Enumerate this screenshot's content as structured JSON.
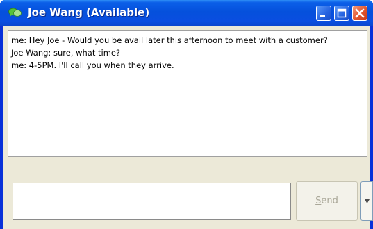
{
  "window": {
    "title": "Joe Wang (Available)",
    "controls": {
      "minimize_icon": "minimize-icon",
      "maximize_icon": "maximize-icon",
      "close_icon": "close-icon"
    }
  },
  "transcript": {
    "messages": [
      "me: Hey Joe - Would you be avail later this afternoon to meet with a  customer?",
      "Joe Wang: sure, what time?",
      "me: 4-5PM. I'll call you when they arrive."
    ]
  },
  "compose": {
    "value": "",
    "send_label_accel": "S",
    "send_label_rest": "end",
    "more_icon": "triangle-down-icon"
  },
  "colors": {
    "titlebar": "#0550dc",
    "client_bg": "#ece9d8",
    "close_button": "#e0552f",
    "disabled_text": "#aaa899"
  }
}
